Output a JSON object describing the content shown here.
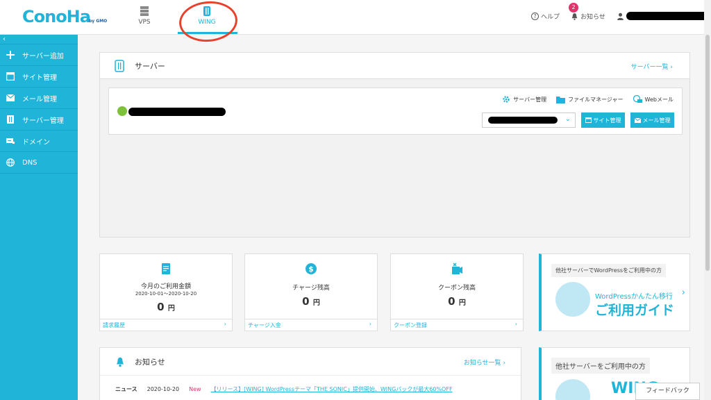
{
  "brand": {
    "logo": "ConoHa",
    "logo_sub": "by GMO"
  },
  "top_tabs": [
    {
      "label": "VPS"
    },
    {
      "label": "WING",
      "active": true
    }
  ],
  "header_right": {
    "help": "ヘルプ",
    "notice": "お知らせ",
    "notice_badge": "2"
  },
  "sidebar": {
    "collapse": "‹",
    "items": [
      {
        "label": "サーバー追加",
        "icon": "plus-icon"
      },
      {
        "label": "サイト管理",
        "icon": "window-icon"
      },
      {
        "label": "メール管理",
        "icon": "mail-icon"
      },
      {
        "label": "サーバー管理",
        "icon": "server-icon"
      },
      {
        "label": "ドメイン",
        "icon": "domain-icon"
      },
      {
        "label": "DNS",
        "icon": "globe-icon"
      }
    ]
  },
  "server_panel": {
    "title": "サーバー",
    "list_link": "サーバー一覧",
    "links": {
      "server_mgmt": "サーバー管理",
      "file_manager": "ファイルマネージャー",
      "webmail": "Webメール"
    },
    "buttons": {
      "site": "サイト管理",
      "mail": "メール管理"
    }
  },
  "cards": [
    {
      "title": "今月のご利用金額",
      "sub": "2020-10-01〜2020-10-20",
      "amount": "0",
      "unit": "円",
      "footer": "請求履歴"
    },
    {
      "title": "チャージ残高",
      "sub": "",
      "amount": "0",
      "unit": "円",
      "footer": "チャージ入金"
    },
    {
      "title": "クーポン残高",
      "sub": "",
      "amount": "0",
      "unit": "円",
      "footer": "クーポン登録"
    }
  ],
  "ad1": {
    "label": "他社サーバーでWordPressをご利用中の方",
    "line1": "WordPressかんたん移行",
    "line2": "ご利用ガイド"
  },
  "news": {
    "title": "お知らせ",
    "list_link": "お知らせ一覧",
    "rows": [
      {
        "category": "ニュース",
        "date": "2020-10-20",
        "new": "New",
        "text": "【リリース】[WING] WordPressテーマ「THE SONIC」提供開始、WINGパックが最大60%OFF"
      }
    ]
  },
  "ad2": {
    "label": "他社サーバーをご利用中の方",
    "brand": "WING"
  },
  "feedback": "フィードバック",
  "colors": {
    "accent": "#1fb4d8",
    "badge": "#e0336b",
    "power": "#7ec23b",
    "annotation": "#e8412e"
  }
}
